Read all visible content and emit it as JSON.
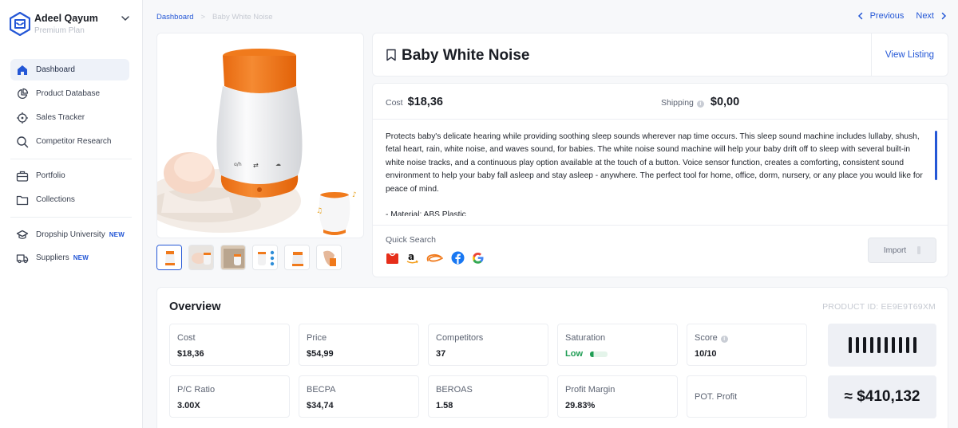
{
  "user": {
    "name": "Adeel Qayum",
    "plan": "Premium Plan"
  },
  "nav": {
    "items": [
      {
        "label": "Dashboard",
        "icon": "home-icon",
        "active": true
      },
      {
        "label": "Product Database",
        "icon": "pie-chart-icon"
      },
      {
        "label": "Sales Tracker",
        "icon": "crosshair-icon"
      },
      {
        "label": "Competitor Research",
        "icon": "search-icon"
      },
      {
        "label": "Portfolio",
        "icon": "briefcase-icon"
      },
      {
        "label": "Collections",
        "icon": "folder-icon"
      },
      {
        "label": "Dropship University",
        "icon": "graduation-cap-icon",
        "badge": "NEW"
      },
      {
        "label": "Suppliers",
        "icon": "truck-icon",
        "badge": "NEW"
      }
    ]
  },
  "breadcrumb": {
    "root": "Dashboard",
    "current": "Baby White Noise"
  },
  "pager": {
    "previous": "Previous",
    "next": "Next"
  },
  "product": {
    "title": "Baby White Noise",
    "view_listing": "View Listing",
    "cost_label": "Cost",
    "cost": "$18,36",
    "shipping_label": "Shipping",
    "shipping": "$0,00",
    "description": "Protects baby's delicate hearing while providing soothing sleep sounds wherever nap time occurs. This sleep sound machine includes lullaby, shush, fetal heart, rain, white noise, and waves sound, for babies. The white noise sound machine will help your baby drift off to sleep with several built-in white noise tracks, and a continuous play option available at the touch of a button. Voice sensor function, creates a comforting, consistent sound environment to help your baby fall asleep and stay asleep - anywhere. The perfect tool for home, office, dorm, nursery, or any place you would like for peace of mind.",
    "description_more": "- Material: ABS Plastic",
    "quick_search_label": "Quick Search",
    "quick_search_icons": [
      "aliexpress-icon",
      "amazon-icon",
      "alibaba-icon",
      "facebook-icon",
      "google-icon"
    ],
    "import_label": "Import"
  },
  "overview": {
    "title": "Overview",
    "product_id": "PRODUCT ID: EE9E9T69XM",
    "metrics": [
      {
        "label": "Cost",
        "value": "$18,36"
      },
      {
        "label": "Price",
        "value": "$54,99"
      },
      {
        "label": "Competitors",
        "value": "37"
      },
      {
        "label": "Saturation",
        "value": "Low",
        "level": 0.2
      },
      {
        "label": "Score",
        "value": "10/10"
      },
      {
        "label": "P/C Ratio",
        "value": "3.00X"
      },
      {
        "label": "BECPA",
        "value": "$34,74"
      },
      {
        "label": "BEROAS",
        "value": "1.58"
      },
      {
        "label": "Profit Margin",
        "value": "29.83%"
      },
      {
        "label": "POT. Profit",
        "value": ""
      }
    ],
    "score_bars": 10,
    "pot_profit": "≈ $410,132"
  },
  "colors": {
    "accent": "#2457d6",
    "brand_orange": "#f07a1c",
    "low_green": "#1f9d54"
  }
}
